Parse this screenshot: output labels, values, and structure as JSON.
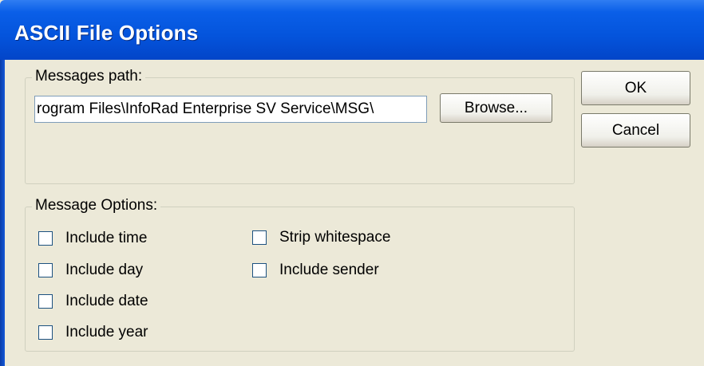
{
  "window": {
    "title": "ASCII File Options"
  },
  "messages_path": {
    "legend": "Messages path:",
    "value": "rogram Files\\InfoRad Enterprise SV Service\\MSG\\",
    "browse_label": "Browse..."
  },
  "buttons": {
    "ok": "OK",
    "cancel": "Cancel"
  },
  "message_options": {
    "legend": "Message Options:",
    "include_time": {
      "label": "Include time",
      "checked": false
    },
    "include_day": {
      "label": "Include day",
      "checked": false
    },
    "include_date": {
      "label": "Include date",
      "checked": false
    },
    "include_year": {
      "label": "Include year",
      "checked": false
    },
    "strip_whitespace": {
      "label": "Strip whitespace",
      "checked": false
    },
    "include_sender": {
      "label": "Include sender",
      "checked": false
    }
  },
  "colors": {
    "titlebar": "#0454dc",
    "dialog_bg": "#ece9d8",
    "checkbox_border": "#1c5180"
  }
}
